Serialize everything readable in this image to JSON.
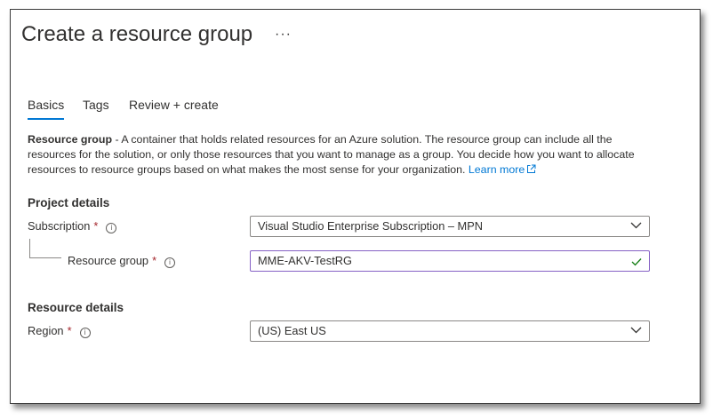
{
  "page": {
    "title": "Create a resource group",
    "more_label": "···"
  },
  "tabs": [
    {
      "label": "Basics",
      "active": true
    },
    {
      "label": "Tags",
      "active": false
    },
    {
      "label": "Review + create",
      "active": false
    }
  ],
  "description": {
    "term": "Resource group",
    "text": " - A container that holds related resources for an Azure solution. The resource group can include all the resources for the solution, or only those resources that you want to manage as a group. You decide how you want to allocate resources to resource groups based on what makes the most sense for your organization. ",
    "link": "Learn more",
    "link_icon": "external-link-icon"
  },
  "project_details": {
    "heading": "Project details",
    "subscription": {
      "label": "Subscription",
      "required": "*",
      "info_icon": "info-icon",
      "value": "Visual Studio Enterprise Subscription – MPN"
    },
    "resource_group": {
      "label": "Resource group",
      "required": "*",
      "info_icon": "info-icon",
      "value": "MME-AKV-TestRG",
      "status_icon": "checkmark-icon"
    }
  },
  "resource_details": {
    "heading": "Resource details",
    "region": {
      "label": "Region",
      "required": "*",
      "info_icon": "info-icon",
      "value": "(US) East US"
    }
  },
  "colors": {
    "accent": "#0078d4",
    "required": "#a4262c",
    "valid": "#107c10",
    "focus_border": "#8661c5"
  }
}
